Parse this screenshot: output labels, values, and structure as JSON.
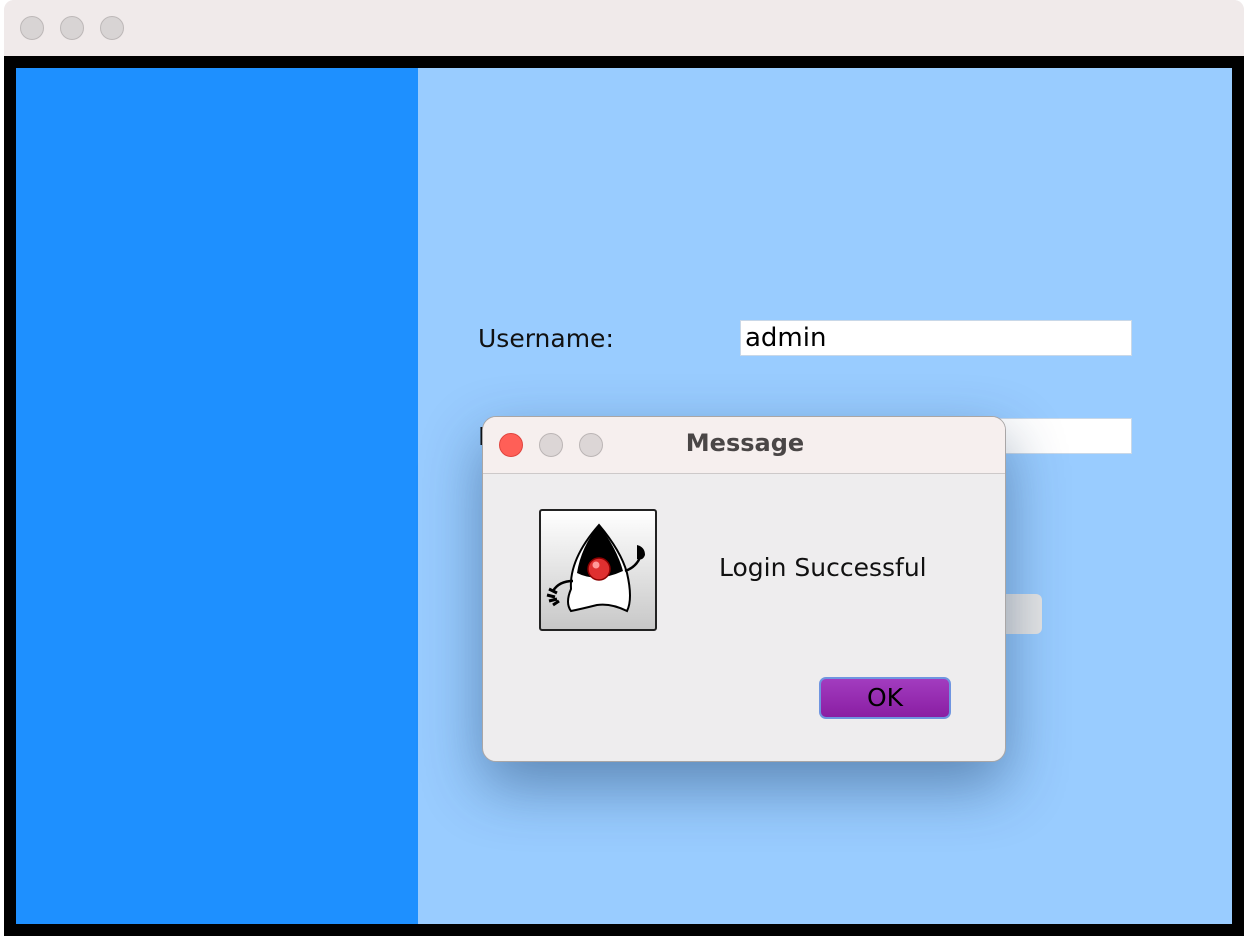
{
  "window": {
    "controls": [
      "close",
      "minimize",
      "zoom"
    ]
  },
  "login_form": {
    "username_label": "Username:",
    "username_value": "admin",
    "password_label_partial": "P"
  },
  "dialog": {
    "title": "Message",
    "message": "Login Successful",
    "ok_label": "OK",
    "icon": "java-duke-icon"
  },
  "colors": {
    "left_panel": "#1e90ff",
    "right_panel": "#99ccff",
    "ok_button": "#9b30b8",
    "close_button": "#ff5f57"
  }
}
